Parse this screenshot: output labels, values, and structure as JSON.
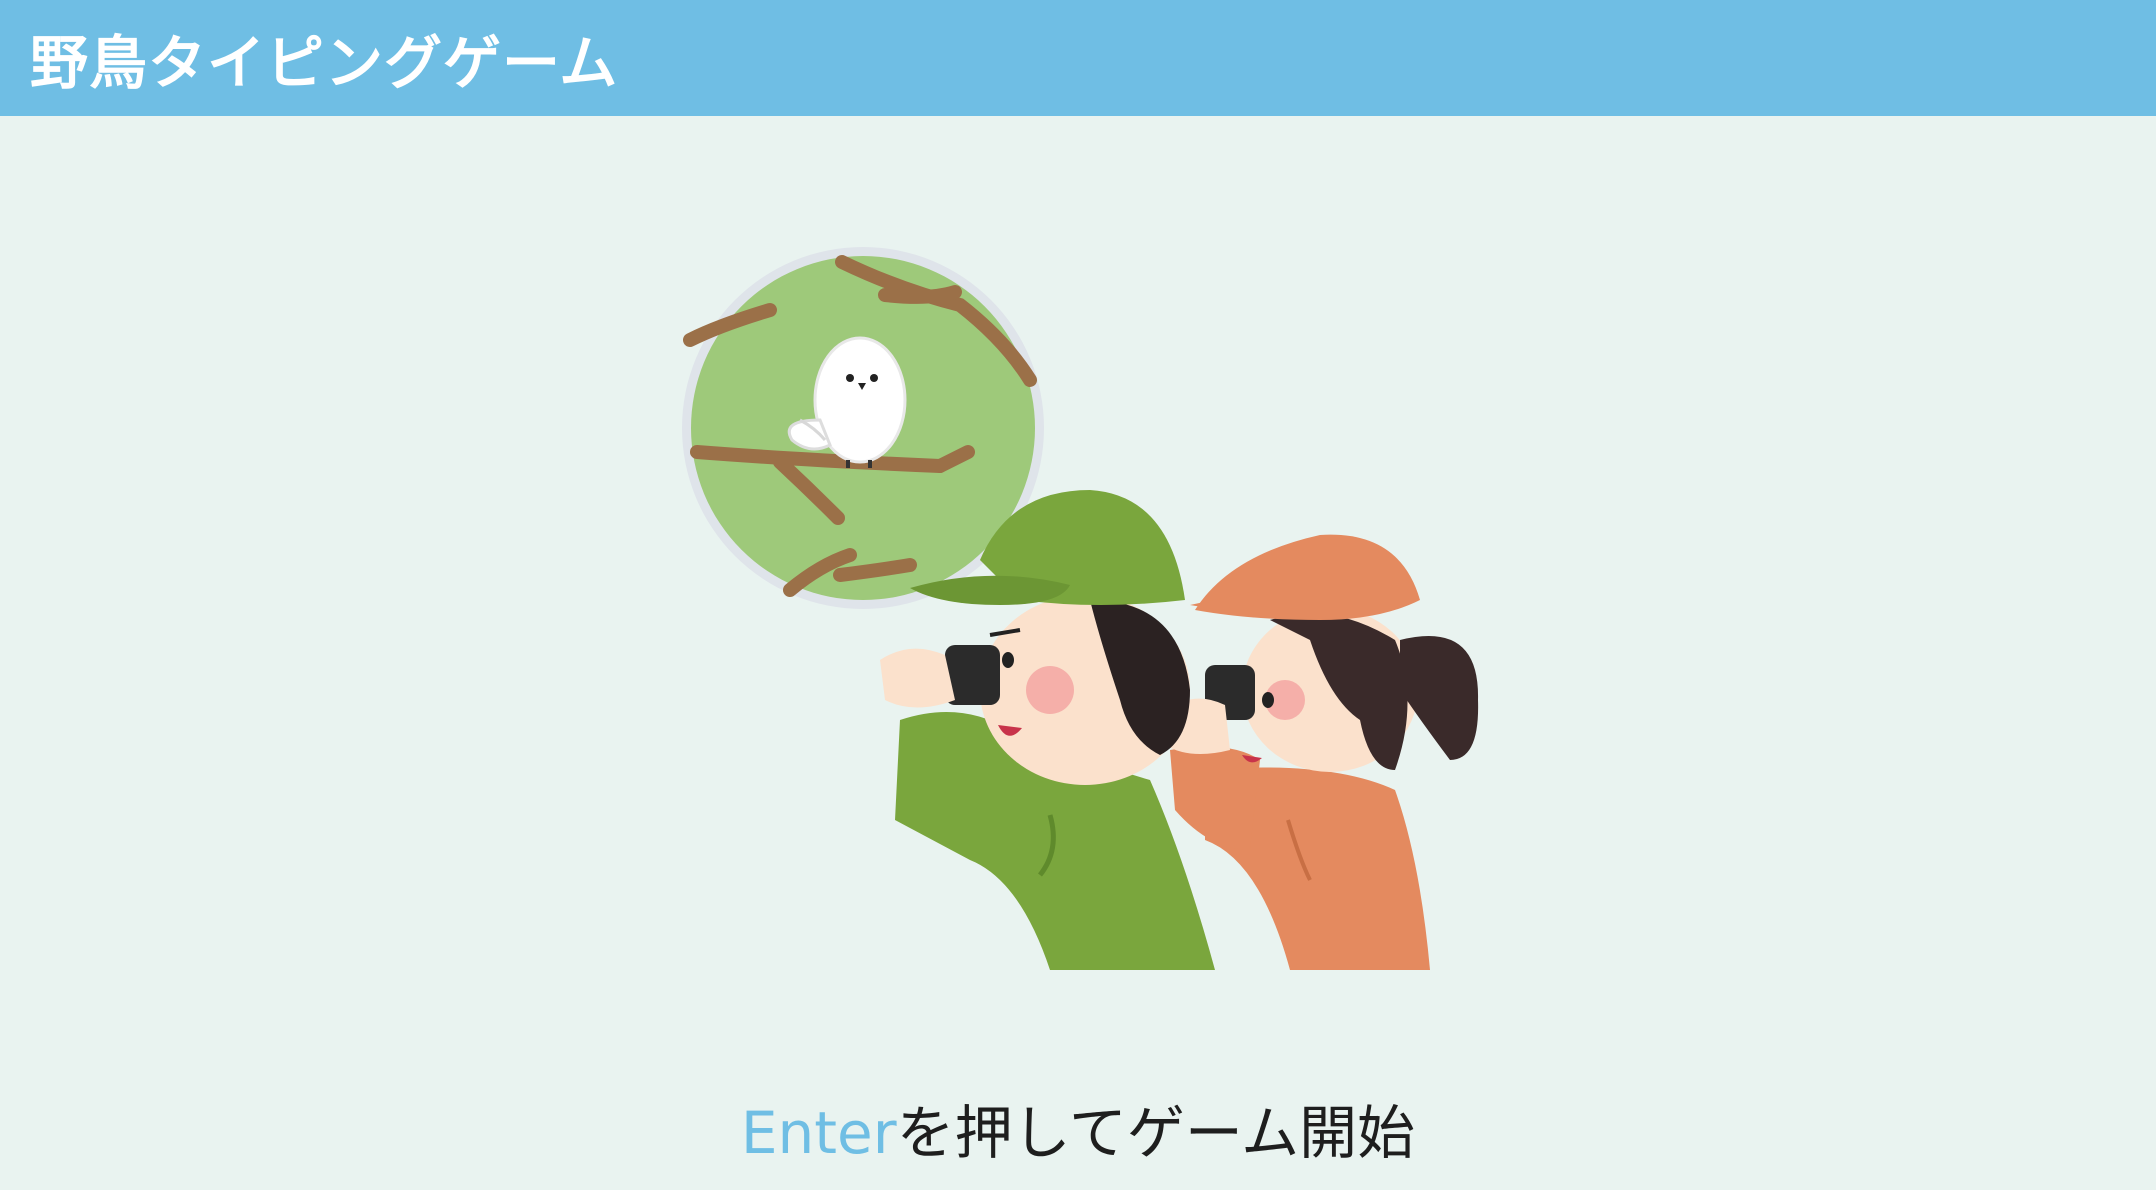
{
  "header": {
    "title": "野鳥タイピングゲーム"
  },
  "main": {
    "illustration_label": "birdwatching-illustration",
    "prompt_key": "Enter",
    "prompt_text": "を押してゲーム開始"
  },
  "colors": {
    "header_bg": "#6fbee4",
    "page_bg": "#e9f3f0",
    "key_accent": "#6fbee4"
  }
}
